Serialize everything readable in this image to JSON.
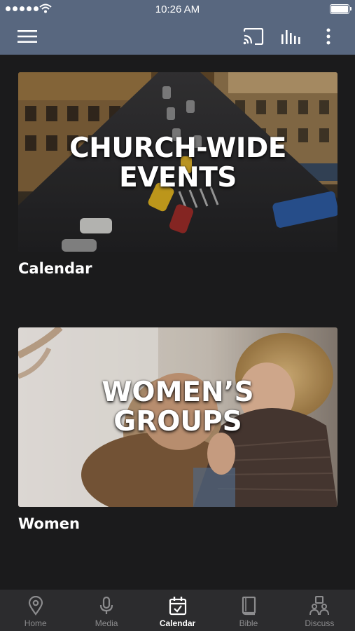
{
  "status_bar": {
    "time": "10:26 AM"
  },
  "cards": [
    {
      "overlay_title": "CHURCH-WIDE EVENTS",
      "label": "Calendar"
    },
    {
      "overlay_title_line1": "WOMEN’S",
      "overlay_title_line2": "GROUPS",
      "label": "Women"
    }
  ],
  "tabs": [
    {
      "label": "Home",
      "icon": "location-pin-icon"
    },
    {
      "label": "Media",
      "icon": "microphone-icon"
    },
    {
      "label": "Calendar",
      "icon": "calendar-check-icon",
      "active": true
    },
    {
      "label": "Bible",
      "icon": "book-icon"
    },
    {
      "label": "Discuss",
      "icon": "people-icon"
    }
  ],
  "colors": {
    "header": "#58677f",
    "background": "#1b1b1c",
    "tabbar": "#2c2c2e",
    "tab_inactive": "#8c8c8e",
    "tab_active": "#ffffff"
  }
}
